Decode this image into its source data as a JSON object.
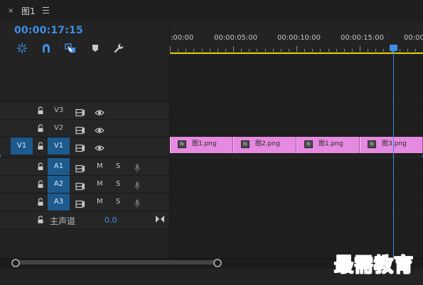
{
  "window": {
    "tab_title": "图1",
    "close_glyph": "×"
  },
  "timeline": {
    "current_timecode": "00:00:17:15",
    "ruler_labels": [
      ":00:00",
      "00:00:05:00",
      "00:00:10:00",
      "00:00:15:00",
      "00:00"
    ],
    "playhead_time": "00:00:17:15",
    "tools": [
      "snap-icon",
      "linked-selection-icon",
      "insert-marker-icon",
      "marker-icon",
      "wrench-icon"
    ]
  },
  "tracks": {
    "video": [
      {
        "name": "V3",
        "source_target": ""
      },
      {
        "name": "V2",
        "source_target": ""
      },
      {
        "name": "V1",
        "source_target": "V1"
      }
    ],
    "audio": [
      {
        "name": "A1",
        "mute": "M",
        "solo": "S"
      },
      {
        "name": "A2",
        "mute": "M",
        "solo": "S"
      },
      {
        "name": "A3",
        "mute": "M",
        "solo": "S"
      }
    ],
    "master": {
      "label": "主声道",
      "value": "0.0"
    }
  },
  "clips": [
    {
      "label": "图1.png",
      "fx": "fx"
    },
    {
      "label": "图2.png",
      "fx": "fx"
    },
    {
      "label": "图1.png",
      "fx": "fx"
    },
    {
      "label": "图3.png",
      "fx": "fx"
    }
  ],
  "watermark": {
    "text": "最需教育"
  },
  "colors": {
    "accent_blue": "#3d8ee6",
    "clip_pink": "#e58ae0",
    "work_area_yellow": "#e3d300",
    "target_blue": "#1d5a8e"
  }
}
